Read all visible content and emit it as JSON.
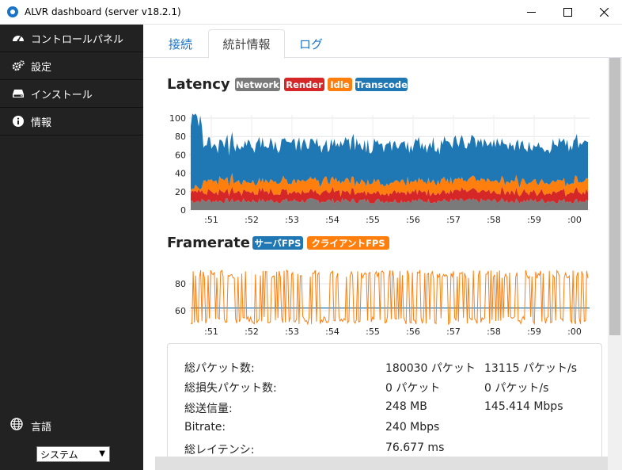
{
  "window": {
    "title": "ALVR dashboard (server v18.2.1)",
    "controls": [
      "minimize-icon",
      "maximize-icon",
      "close-icon"
    ]
  },
  "sidebar": {
    "items": [
      {
        "label": "コントロールパネル",
        "icon": "dashboard-icon"
      },
      {
        "label": "設定",
        "icon": "gears-icon"
      },
      {
        "label": "インストール",
        "icon": "hdd-icon"
      },
      {
        "label": "情報",
        "icon": "info-icon"
      }
    ],
    "language_label": "言語",
    "language_icon": "globe-icon",
    "language_value": "システム"
  },
  "tabs": [
    {
      "label": "接続",
      "active": false
    },
    {
      "label": "統計情報",
      "active": true
    },
    {
      "label": "ログ",
      "active": false
    }
  ],
  "latency": {
    "title": "Latency",
    "legend": [
      {
        "label": "Network",
        "color": "#7a7a7a"
      },
      {
        "label": "Render",
        "color": "#d62728"
      },
      {
        "label": "Idle",
        "color": "#ff7f0e"
      },
      {
        "label": "Transcode",
        "color": "#1f77b4"
      }
    ]
  },
  "framerate": {
    "title": "Framerate",
    "legend": [
      {
        "label": "サーバFPS",
        "color": "#1f77b4"
      },
      {
        "label": "クライアントFPS",
        "color": "#ff7f0e"
      }
    ]
  },
  "chart_data": [
    {
      "type": "area",
      "stacked": true,
      "y_ticks": [
        "0",
        "20",
        "40",
        "60",
        "80",
        "100"
      ],
      "ylim": [
        0,
        100
      ],
      "x_ticks": [
        ":51",
        ":52",
        ":53",
        ":54",
        ":55",
        ":56",
        ":57",
        ":58",
        ":59",
        ":00"
      ],
      "series": [
        {
          "name": "Network",
          "approx_level": 10
        },
        {
          "name": "Render",
          "approx_level": 10
        },
        {
          "name": "Idle",
          "approx_level": 12
        },
        {
          "name": "Transcode",
          "approx_level": 40
        }
      ],
      "grid": true
    },
    {
      "type": "line",
      "y_ticks": [
        "60",
        "80"
      ],
      "ylim": [
        50,
        90
      ],
      "x_ticks": [
        ":51",
        ":52",
        ":53",
        ":54",
        ":55",
        ":56",
        ":57",
        ":58",
        ":59",
        ":00"
      ],
      "series": [
        {
          "name": "サーバFPS",
          "approx_level": 62
        },
        {
          "name": "クライアントFPS",
          "approx_range": [
            50,
            90
          ]
        }
      ],
      "grid": true
    }
  ],
  "stats": [
    {
      "label": "総パケット数:",
      "value1": "180030 パケット",
      "value2": "13115 パケット/s"
    },
    {
      "label": "総損失パケット数:",
      "value1": "0 パケット",
      "value2": "0 パケット/s"
    },
    {
      "label": "総送信量:",
      "value1": "248 MB",
      "value2": "145.414 Mbps"
    },
    {
      "label": "Bitrate:",
      "value1": "240 Mbps",
      "value2": ""
    },
    {
      "label": "総レイテンシ:",
      "value1": "76.677 ms",
      "value2": ""
    }
  ]
}
